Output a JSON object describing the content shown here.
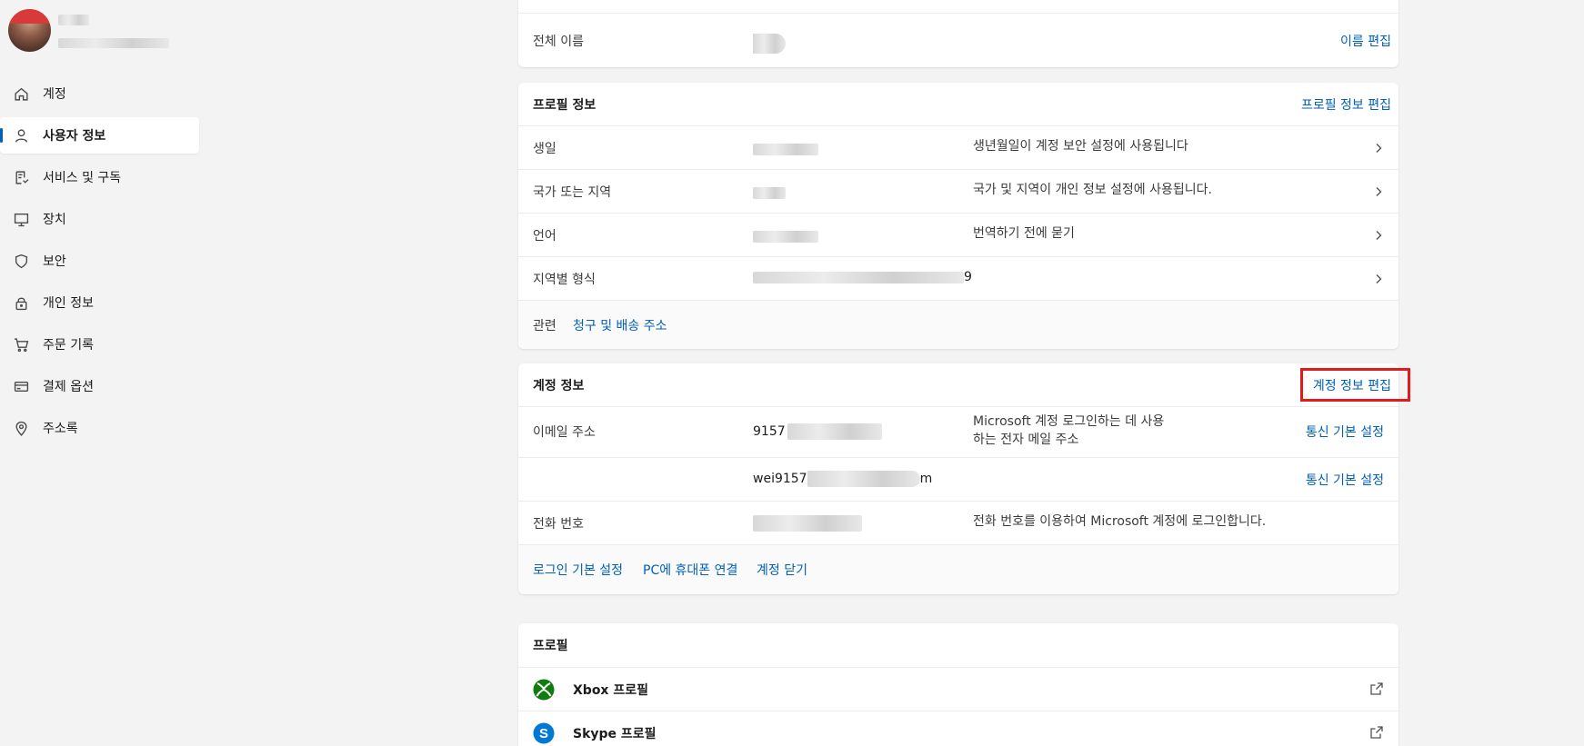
{
  "sidebar": {
    "items": [
      {
        "label": "계정",
        "icon": "home-icon"
      },
      {
        "label": "사용자 정보",
        "icon": "person-icon",
        "active": true
      },
      {
        "label": "서비스 및 구독",
        "icon": "subscription-icon"
      },
      {
        "label": "장치",
        "icon": "monitor-icon"
      },
      {
        "label": "보안",
        "icon": "shield-icon"
      },
      {
        "label": "개인 정보",
        "icon": "lock-icon"
      },
      {
        "label": "주문 기록",
        "icon": "cart-icon"
      },
      {
        "label": "결제 옵션",
        "icon": "card-icon"
      },
      {
        "label": "주소록",
        "icon": "location-icon"
      }
    ]
  },
  "name_card": {
    "label": "전체 이름",
    "edit_link": "이름 편집"
  },
  "profile_card": {
    "title": "프로필 정보",
    "edit_link": "프로필 정보 편집",
    "rows": [
      {
        "label": "생일",
        "desc": "생년월일이 계정 보안 설정에 사용됩니다"
      },
      {
        "label": "국가 또는 지역",
        "desc": "국가 및 지역이 개인 정보 설정에 사용됩니다."
      },
      {
        "label": "언어",
        "desc": "번역하기 전에 묻기"
      },
      {
        "label": "지역별 형식",
        "value_suffix": "9",
        "desc": ""
      }
    ],
    "related_label": "관련",
    "related_link": "청구 및 배송 주소"
  },
  "account_card": {
    "title": "계정 정보",
    "edit_link": "계정 정보 편집",
    "email_label": "이메일 주소",
    "email1_prefix": "9157",
    "email1_desc_line1": "Microsoft 계정 로그인하는 데 사용",
    "email1_desc_line2": "하는 전자 메일 주소",
    "email1_link": "통신 기본 설정",
    "email2_prefix": "wei9157",
    "email2_suffix": "m",
    "email2_link": "통신 기본 설정",
    "phone_label": "전화 번호",
    "phone_desc": "전화 번호를 이용하여 Microsoft 계정에 로그인합니다.",
    "footer_links": [
      "로그인 기본 설정",
      "PC에 휴대폰 연결",
      "계정 닫기"
    ]
  },
  "profiles_card": {
    "title": "프로필",
    "items": [
      {
        "label": "Xbox 프로필",
        "icon": "xbox-icon",
        "color": "#107c10"
      },
      {
        "label": "Skype 프로필",
        "icon": "skype-icon",
        "color": "#0078d4"
      }
    ]
  },
  "colors": {
    "accent": "#005fb8",
    "highlight": "#e11b1b"
  }
}
